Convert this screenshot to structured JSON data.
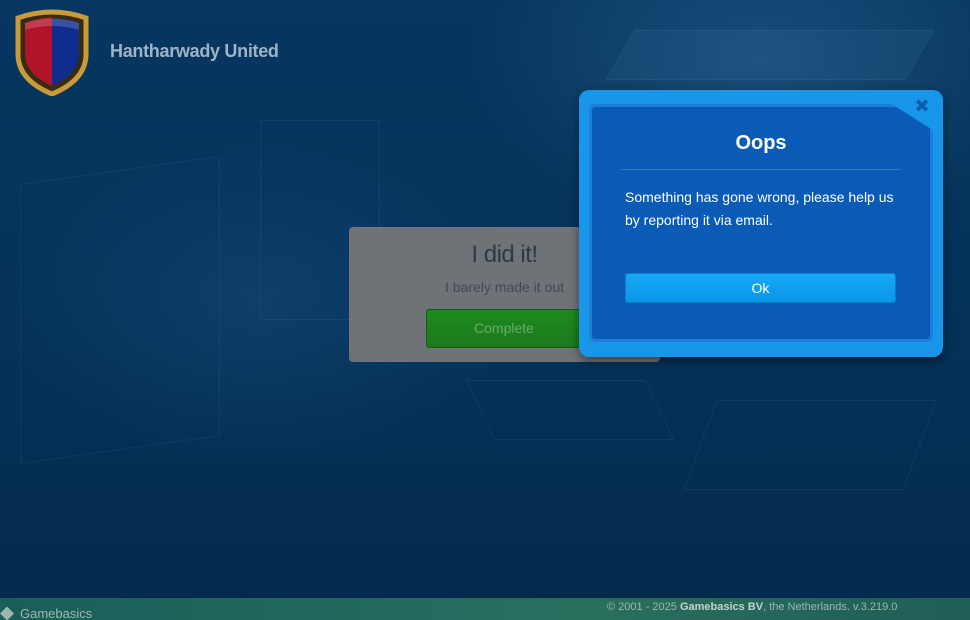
{
  "header": {
    "club_name": "Hantharwady United",
    "crest_colors": {
      "left": "#b0132a",
      "right": "#0f2c8f",
      "rim": "#c79a3a"
    }
  },
  "task": {
    "title": "I did it!",
    "subtitle": "I barely made it out",
    "button_label": "Complete"
  },
  "dialog": {
    "title": "Oops",
    "message": "Something has gone wrong, please help us by reporting it via email.",
    "ok_label": "Ok",
    "close_icon": "close-icon"
  },
  "footer": {
    "brand": "Gamebasics",
    "copyright_prefix": "© 2001 - 2025 ",
    "company": "Gamebasics BV",
    "copyright_suffix": ", the Netherlands. v.3.219.0"
  },
  "colors": {
    "background": "#06345c",
    "dialog_outer": "#1896ea",
    "dialog_inner": "#0a5bb5",
    "ok_button": "#0a96ea",
    "complete_button": "#1a7a1a",
    "footer": "#2a6f5e"
  }
}
